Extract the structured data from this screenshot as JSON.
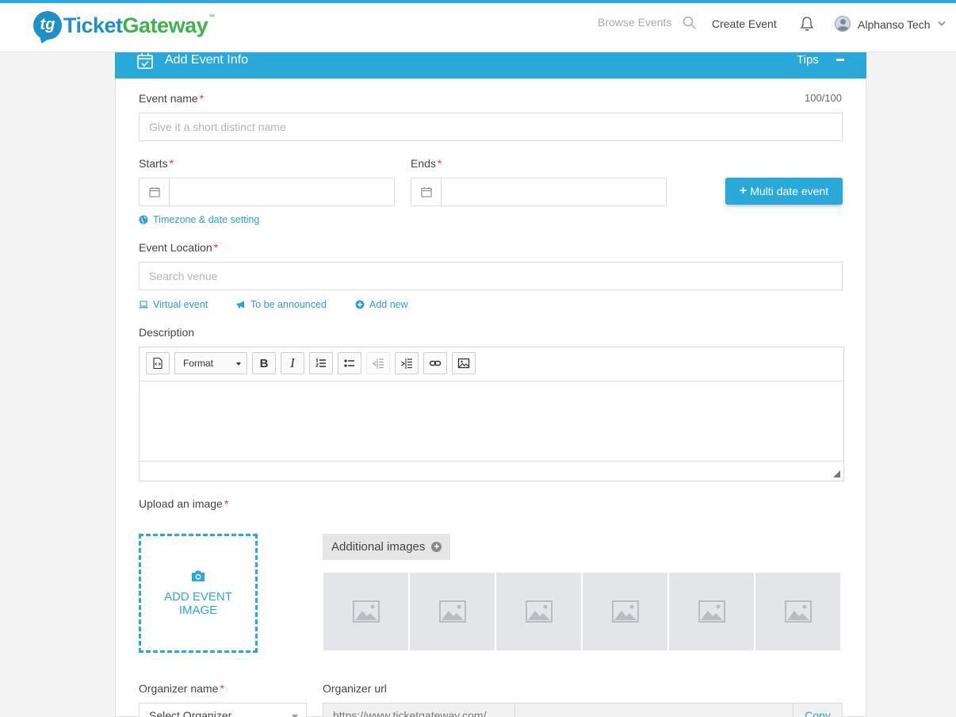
{
  "header": {
    "logo": {
      "mark": "tg",
      "text_a": "Ticket",
      "text_b": "Gateway",
      "tm": "™"
    },
    "nav": {
      "browse": "Browse Events",
      "create": "Create Event"
    },
    "user": {
      "name": "Alphanso Tech"
    }
  },
  "card": {
    "title": "Add Event Info",
    "tips": "Tips"
  },
  "form": {
    "event_name": {
      "label": "Event name",
      "required": "*",
      "placeholder": "Give it a short distinct name",
      "counter": "100/100"
    },
    "starts": {
      "label": "Starts",
      "required": "*"
    },
    "ends": {
      "label": "Ends",
      "required": "*"
    },
    "multi_date": {
      "plus": "+",
      "label": "Multi date event"
    },
    "timezone_link": "Timezone & date setting",
    "location": {
      "label": "Event Location",
      "required": "*",
      "placeholder": "Search venue"
    },
    "location_links": {
      "virtual": "Virtual event",
      "announced": "To be announced",
      "add_new": "Add new"
    },
    "description": {
      "label": "Description",
      "format": "Format",
      "bold": "B",
      "italic": "I"
    },
    "upload": {
      "label": "Upload an image",
      "required": "*",
      "box_text": "ADD EVENT IMAGE"
    },
    "additional_images": {
      "label": "Additional images",
      "plus": "+"
    },
    "organizer_name": {
      "label": "Organizer name",
      "required": "*",
      "value": "Select Organizer"
    },
    "organizer_url": {
      "label": "Organizer url",
      "prefix": "https://www.ticketgateway.com/",
      "copy": "Copy"
    }
  },
  "colors": {
    "accent": "#29a9d9",
    "required": "#e8383d",
    "link": "#2e9fd0"
  }
}
